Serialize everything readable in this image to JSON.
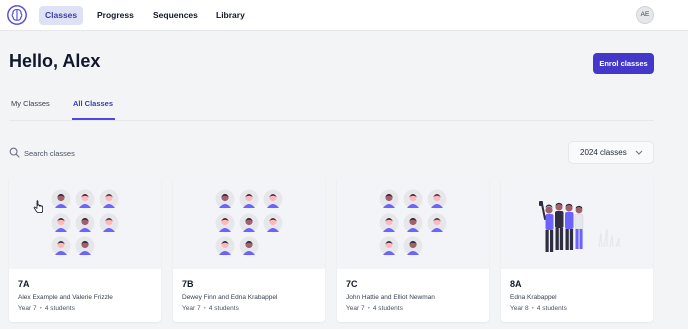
{
  "nav": {
    "items": [
      {
        "label": "Classes",
        "active": true
      },
      {
        "label": "Progress",
        "active": false
      },
      {
        "label": "Sequences",
        "active": false
      },
      {
        "label": "Library",
        "active": false
      }
    ],
    "avatar_initials": "AE"
  },
  "header": {
    "greeting": "Hello, Alex",
    "enrol_label": "Enrol classes"
  },
  "tabs": [
    {
      "label": "My Classes",
      "active": false
    },
    {
      "label": "All Classes",
      "active": true
    }
  ],
  "search": {
    "placeholder": "Search classes",
    "value": ""
  },
  "year_filter": {
    "selected": "2024 classes"
  },
  "classes": [
    {
      "name": "7A",
      "teachers": "Alex Example and Valerie Frizzle",
      "year": "Year 7",
      "students": "4 students"
    },
    {
      "name": "7B",
      "teachers": "Dewey Finn and Edna Krabappel",
      "year": "Year 7",
      "students": "4 students"
    },
    {
      "name": "7C",
      "teachers": "John Hattie and Elliot Newman",
      "year": "Year 7",
      "students": "4 students"
    },
    {
      "name": "8A",
      "teachers": "Edna Krabappel",
      "year": "Year 8",
      "students": "4 students"
    }
  ],
  "icons": {
    "logo": "brain-logo-icon",
    "search": "search-icon",
    "dropdown": "chevron-down-icon",
    "cursor": "mouse-pointer-icon"
  },
  "colors": {
    "accent": "#4338ca",
    "nav_active_bg": "#dfe1f5",
    "illustration_purple": "#6c63ff"
  }
}
